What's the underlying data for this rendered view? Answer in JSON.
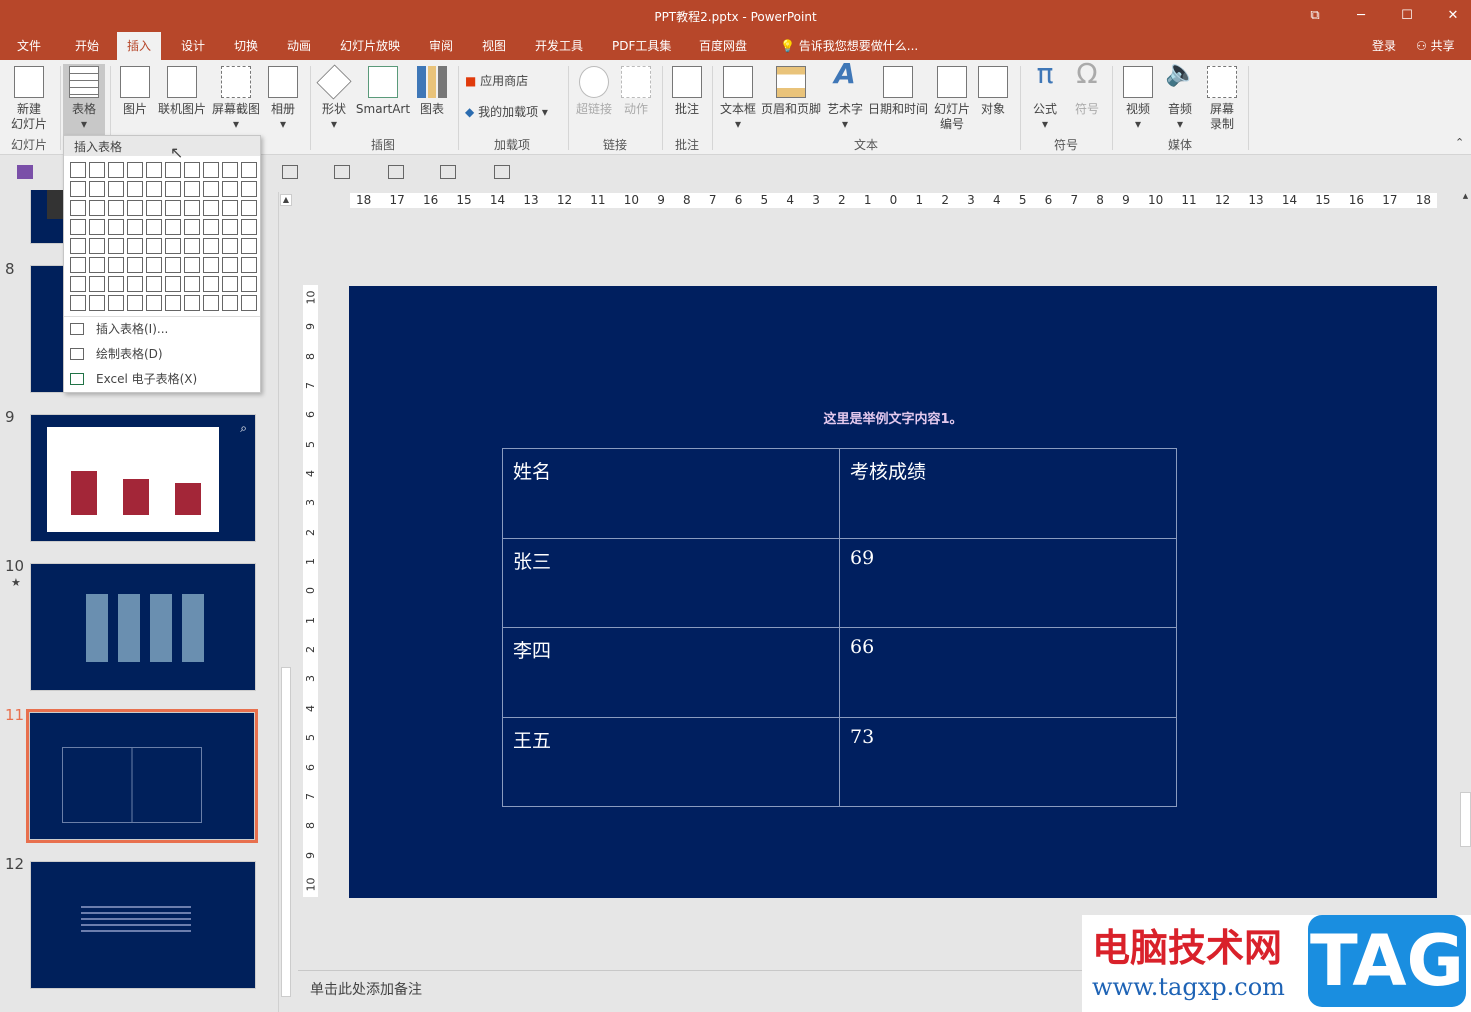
{
  "window": {
    "title": "PPT教程2.pptx - PowerPoint",
    "buttons": {
      "restore": "⧉",
      "minimize": "─",
      "maximize": "☐",
      "close": "✕"
    }
  },
  "tabs": [
    "文件",
    "开始",
    "插入",
    "设计",
    "切换",
    "动画",
    "幻灯片放映",
    "审阅",
    "视图",
    "开发工具",
    "PDF工具集",
    "百度网盘"
  ],
  "tell_me": "告诉我您想要做什么...",
  "login": "登录",
  "share": "共享",
  "ribbon": {
    "buttons": {
      "new_slide": "新建\n幻灯片",
      "table": "表格",
      "picture": "图片",
      "online_picture": "联机图片",
      "screenshot": "屏幕截图",
      "album": "相册",
      "shapes": "形状",
      "smartart": "SmartArt",
      "chart": "图表",
      "store": "应用商店",
      "my_addins": "我的加载项",
      "hyperlink": "超链接",
      "action": "动作",
      "comment": "批注",
      "textbox": "文本框",
      "header_footer": "页眉和页脚",
      "wordart": "艺术字",
      "datetime": "日期和时间",
      "slide_number": "幻灯片\n编号",
      "object": "对象",
      "equation": "公式",
      "symbol": "符号",
      "video": "视频",
      "audio": "音频",
      "screen_record": "屏幕\n录制"
    },
    "groups": {
      "slides": "幻灯片",
      "illustrations": "插图",
      "addins": "加载项",
      "links": "链接",
      "comments": "批注",
      "text": "文本",
      "symbols": "符号",
      "media": "媒体"
    }
  },
  "table_menu": {
    "header": "插入表格",
    "items": [
      "插入表格(I)...",
      "绘制表格(D)",
      "Excel 电子表格(X)"
    ]
  },
  "thumbnails": [
    {
      "num": "8"
    },
    {
      "num": "9"
    },
    {
      "num": "10",
      "star": "★"
    },
    {
      "num": "11",
      "selected": true
    },
    {
      "num": "12"
    }
  ],
  "hruler": [
    "18",
    "17",
    "16",
    "15",
    "14",
    "13",
    "12",
    "11",
    "10",
    "9",
    "8",
    "7",
    "6",
    "5",
    "4",
    "3",
    "2",
    "1",
    "0",
    "1",
    "2",
    "3",
    "4",
    "5",
    "6",
    "7",
    "8",
    "9",
    "10",
    "11",
    "12",
    "13",
    "14",
    "15",
    "16",
    "17",
    "18"
  ],
  "vruler": [
    "10",
    "9",
    "8",
    "7",
    "6",
    "5",
    "4",
    "3",
    "2",
    "1",
    "0",
    "1",
    "2",
    "3",
    "4",
    "5",
    "6",
    "7",
    "8",
    "9",
    "10"
  ],
  "slide": {
    "title": "这里是举例文字内容1。",
    "table": [
      [
        "姓名",
        "考核成绩"
      ],
      [
        "张三",
        "69"
      ],
      [
        "李四",
        "66"
      ],
      [
        "王五",
        "73"
      ]
    ]
  },
  "notes_placeholder": "单击此处添加备注",
  "watermark": {
    "line1": "电脑技术网",
    "line2": "www.tagxp.com",
    "tag": "TAG"
  },
  "colors": {
    "accent": "#b7472a",
    "slide_bg": "#001f5f",
    "selected_thumb": "#e8704e"
  }
}
